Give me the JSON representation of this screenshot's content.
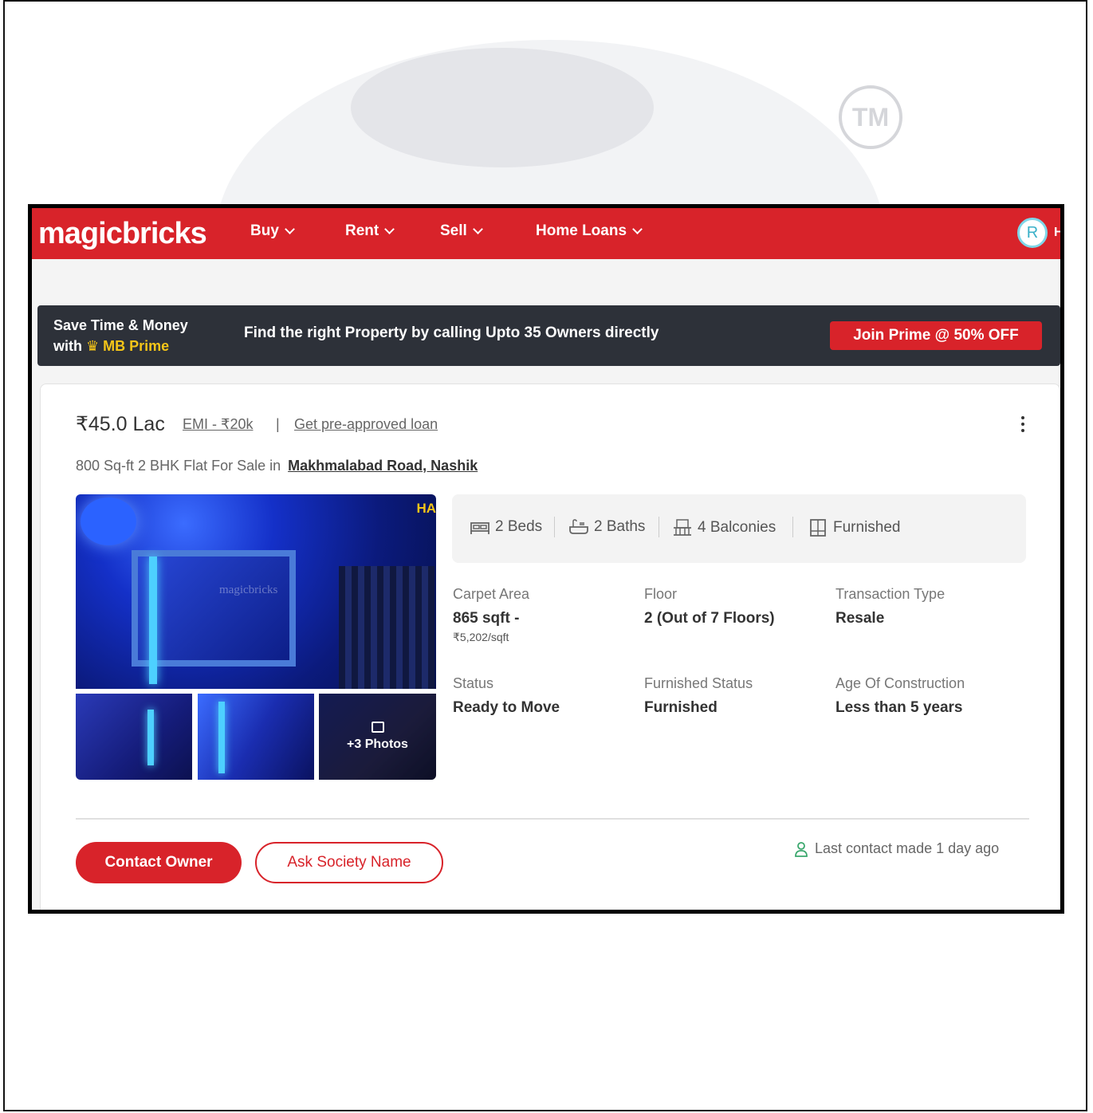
{
  "watermark": {
    "tm_mark": "TM"
  },
  "header": {
    "logo": "magicbricks",
    "nav": [
      {
        "label": "Buy"
      },
      {
        "label": "Rent"
      },
      {
        "label": "Sell"
      },
      {
        "label": "Home Loans"
      }
    ],
    "avatar_initial": "R",
    "avatar_edge_text": "H"
  },
  "prime_banner": {
    "line1": "Save Time & Money",
    "line2_prefix": "with",
    "line2_brand": "MB Prime",
    "message": "Find the right Property by calling Upto 35 Owners directly",
    "cta": "Join Prime @ 50% OFF"
  },
  "listing": {
    "price": "₹45.0 Lac",
    "emi": "EMI - ₹20k",
    "separator": "|",
    "loan_link": "Get pre-approved loan",
    "subtitle_prefix": "800 Sq-ft 2 BHK Flat For Sale in",
    "locality": "Makhmalabad Road, Nashik",
    "photo_watermark": "magicbricks",
    "photo_badge": "HA",
    "more_photos": "+3 Photos",
    "amenities": [
      {
        "icon": "bed-icon",
        "label": "2 Beds"
      },
      {
        "icon": "bath-icon",
        "label": "2 Baths"
      },
      {
        "icon": "balcony-icon",
        "label": "4 Balconies"
      },
      {
        "icon": "furnished-icon",
        "label": "Furnished"
      }
    ],
    "details": [
      {
        "label": "Carpet Area",
        "value": "865 sqft -",
        "sub": "₹5,202/sqft"
      },
      {
        "label": "Floor",
        "value": "2 (Out of 7 Floors)"
      },
      {
        "label": "Transaction Type",
        "value": "Resale"
      },
      {
        "label": "Status",
        "value": "Ready to Move"
      },
      {
        "label": "Furnished Status",
        "value": "Furnished"
      },
      {
        "label": "Age Of Construction",
        "value": "Less than 5 years"
      }
    ],
    "contact_button": "Contact Owner",
    "ask_button": "Ask Society Name",
    "last_contact": "Last contact made 1 day ago"
  },
  "colors": {
    "brand_red": "#d8232a",
    "banner_dark": "#2d3139",
    "prime_gold": "#f5c518"
  }
}
